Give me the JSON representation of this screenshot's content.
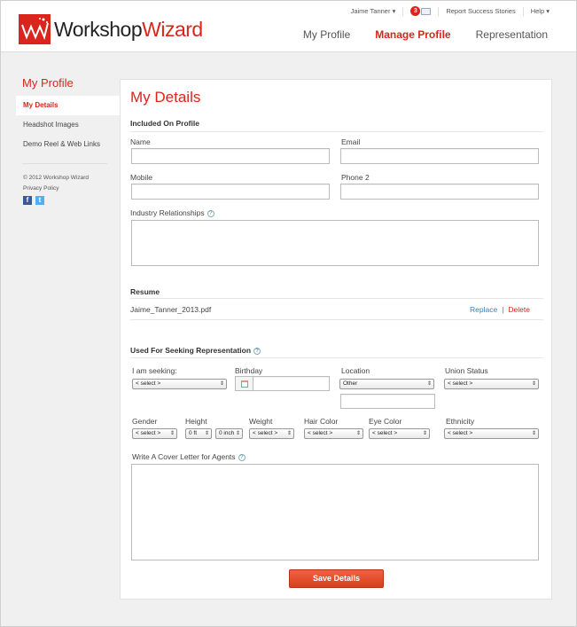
{
  "brand": {
    "part1": "Workshop",
    "part2": "Wizard"
  },
  "topbar": {
    "user": "Jaime Tanner ▾",
    "message_count": "3",
    "report": "Report Success Stories",
    "help": "Help ▾"
  },
  "nav": [
    {
      "label": "My Profile",
      "active": false
    },
    {
      "label": "Manage Profile",
      "active": true
    },
    {
      "label": "Representation",
      "active": false
    }
  ],
  "sidebar": {
    "title": "My Profile",
    "items": [
      {
        "label": "My Details",
        "active": true
      },
      {
        "label": "Headshot Images",
        "active": false
      },
      {
        "label": "Demo Reel & Web Links",
        "active": false
      }
    ],
    "copyright": "© 2012 Workshop Wizard",
    "privacy": "Privacy Policy"
  },
  "page": {
    "title": "My Details",
    "included": {
      "heading": "Included On Profile",
      "name_label": "Name",
      "name_value": "",
      "email_label": "Email",
      "email_value": "",
      "mobile_label": "Mobile",
      "mobile_value": "",
      "phone2_label": "Phone 2",
      "phone2_value": "",
      "industry_label": "Industry Relationships",
      "industry_value": ""
    },
    "resume": {
      "heading": "Resume",
      "filename": "Jaime_Tanner_2013.pdf",
      "replace": "Replace",
      "divider": "|",
      "delete": "Delete"
    },
    "seeking": {
      "heading": "Used For Seeking Representation",
      "seeking_label": "I am seeking:",
      "seeking_value": "< select >",
      "birthday_label": "Birthday",
      "birthday_value": "",
      "location_label": "Location",
      "location_value": "Other",
      "location_other": "",
      "union_label": "Union Status",
      "union_value": "< select >",
      "gender_label": "Gender",
      "gender_value": "< select >",
      "height_label": "Height",
      "height_ft": "0 ft",
      "height_in": "0 inch",
      "weight_label": "Weight",
      "weight_value": "< select >",
      "hair_label": "Hair Color",
      "hair_value": "< select >",
      "eye_label": "Eye Color",
      "eye_value": "< select >",
      "ethnicity_label": "Ethnicity",
      "ethnicity_value": "< select >",
      "cover_label": "Write A Cover Letter for Agents",
      "cover_value": ""
    },
    "save_label": "Save Details"
  },
  "colors": {
    "accent": "#d9251c",
    "link": "#3a7cc0",
    "button": "#e04a28"
  }
}
